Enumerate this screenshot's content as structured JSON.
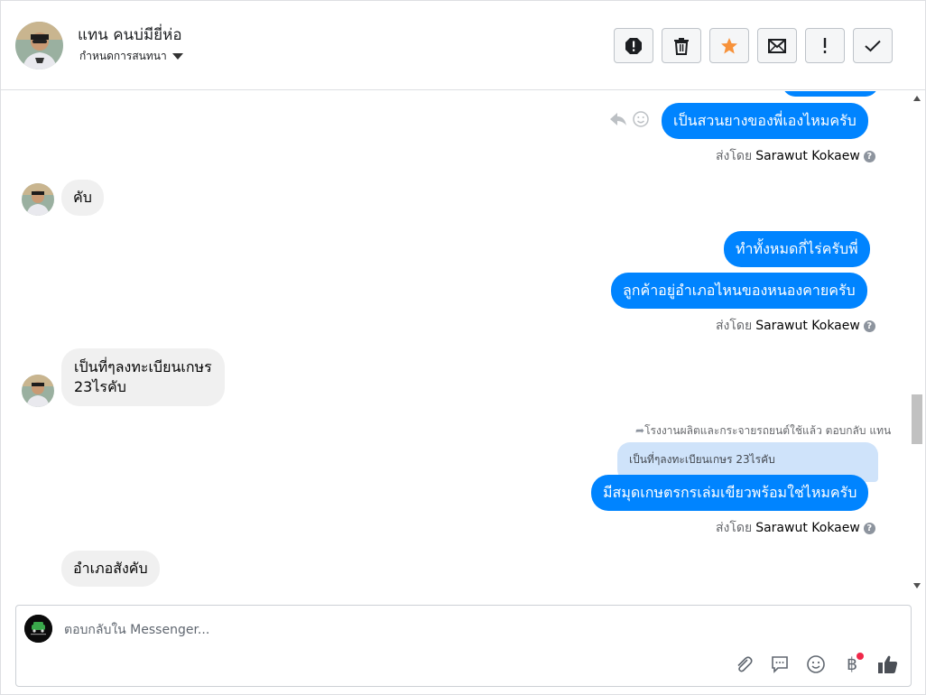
{
  "header": {
    "contact_name": "แทน คนบ่มียี่ห่อ",
    "assign_label": "กำหนดการสนทนา",
    "actions": [
      {
        "name": "report-spam-button",
        "icon": "alert-octagon-icon"
      },
      {
        "name": "delete-button",
        "icon": "trash-icon"
      },
      {
        "name": "star-button",
        "icon": "star-icon",
        "color": "#f7923b"
      },
      {
        "name": "mark-unread-button",
        "icon": "envelope-icon"
      },
      {
        "name": "follow-up-button",
        "icon": "exclamation-icon"
      },
      {
        "name": "mark-done-button",
        "icon": "check-icon"
      }
    ]
  },
  "messages": {
    "m1": {
      "text": "เป็นสวนยางของพี่เองไหมครับ"
    },
    "sent_by_prefix": "ส่งโดย",
    "sent_by_name": "Sarawut Kokaew",
    "m2": {
      "text": "คับ"
    },
    "m3": {
      "text": "ทำทั้งหมดกี่ไร่ครับพี่"
    },
    "m4": {
      "text": "ลูกค้าอยู่อำเภอไหนของหนองคายครับ"
    },
    "m5": {
      "line1": "เป็นที่ๆลงทะเบียนเกษร",
      "line2": "23ไรคับ"
    },
    "reply_note": "โรงงานผลิตและกระจายรถยนต์ใช้แล้ว ตอบกลับ แทน",
    "quoted": "เป็นที่ๆลงทะเบียนเกษร 23ไรคับ",
    "m6": {
      "text": "มีสมุดเกษตรกรเล่มเขียวพร้อมใช่ไหมครับ"
    },
    "m7": {
      "text": "อำเภอสังคับ"
    }
  },
  "composer": {
    "placeholder": "ตอบกลับใน Messenger..."
  },
  "colors": {
    "outgoing": "#0084ff",
    "incoming": "#f0f0f0",
    "quote": "#cfe3fa",
    "star": "#f7923b",
    "notify_dot": "#f02849"
  }
}
